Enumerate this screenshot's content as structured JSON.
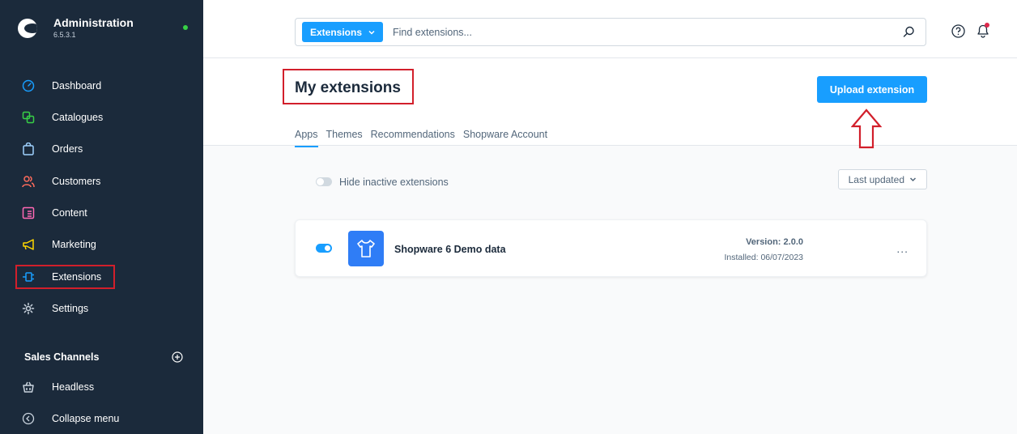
{
  "app": {
    "title": "Administration",
    "version": "6.5.3.1"
  },
  "colors": {
    "sidebar_bg": "#1b2a3b",
    "accent": "#189eff",
    "highlight": "#d21f2b",
    "status_online": "#37d046"
  },
  "sidebar": {
    "items": [
      {
        "label": "Dashboard",
        "icon": "gauge-icon"
      },
      {
        "label": "Catalogues",
        "icon": "catalogue-icon"
      },
      {
        "label": "Orders",
        "icon": "shopping-bag-icon"
      },
      {
        "label": "Customers",
        "icon": "users-icon"
      },
      {
        "label": "Content",
        "icon": "content-icon"
      },
      {
        "label": "Marketing",
        "icon": "megaphone-icon"
      },
      {
        "label": "Extensions",
        "icon": "plug-icon"
      },
      {
        "label": "Settings",
        "icon": "gear-icon"
      }
    ],
    "sales_channels_title": "Sales Channels",
    "sales_channels": [
      {
        "label": "Headless",
        "icon": "basket-icon"
      }
    ],
    "collapse_label": "Collapse menu"
  },
  "search": {
    "type_label": "Extensions",
    "placeholder": "Find extensions..."
  },
  "page": {
    "title": "My extensions",
    "upload_label": "Upload extension",
    "tabs": [
      "Apps",
      "Themes",
      "Recommendations",
      "Shopware Account"
    ],
    "filter_label": "Hide inactive extensions",
    "sort_label": "Last updated"
  },
  "extensions": [
    {
      "name": "Shopware 6 Demo data",
      "version": "Version: 2.0.0",
      "installed": "Installed: 06/07/2023",
      "more": "..."
    }
  ]
}
